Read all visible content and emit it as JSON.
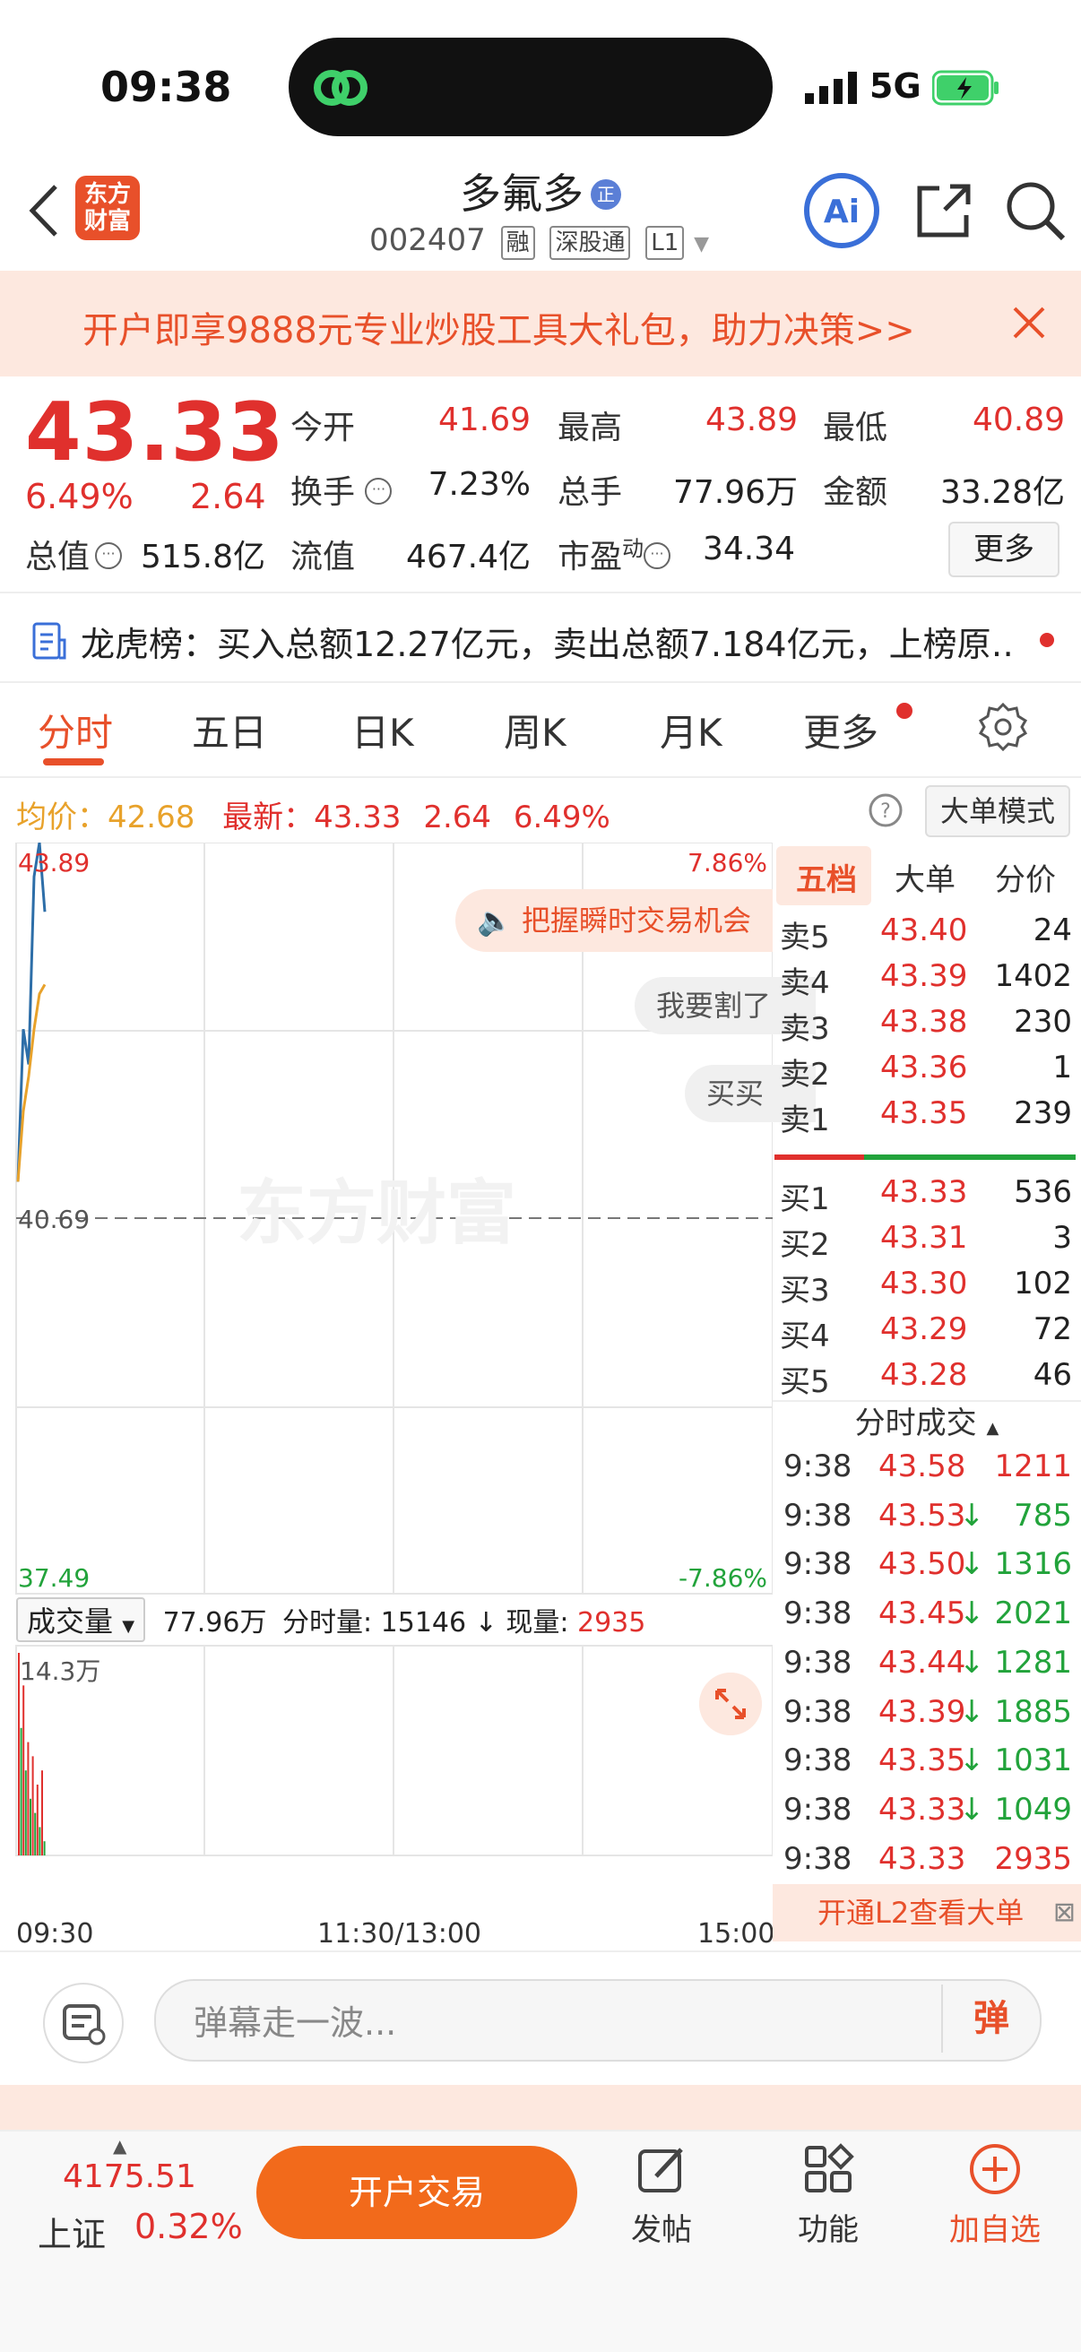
{
  "status": {
    "time": "09:38",
    "network": "5G"
  },
  "header": {
    "title": "多氟多",
    "title_badge": "正",
    "logo": "东方财富",
    "code": "002407",
    "tags": [
      "融",
      "深股通",
      "L1"
    ],
    "ai_label": "Ai"
  },
  "promo": {
    "text": "开户即享9888元专业炒股工具大礼包，助力决策>>"
  },
  "quote": {
    "price": "43.33",
    "change_pct": "6.49%",
    "change": "2.64",
    "open_label": "今开",
    "open": "41.69",
    "high_label": "最高",
    "high": "43.89",
    "low_label": "最低",
    "low": "40.89",
    "turnover_label": "换手",
    "turnover": "7.23%",
    "volume_label": "总手",
    "volume": "77.96万",
    "amount_label": "金额",
    "amount": "33.28亿",
    "mktcap_label": "总值",
    "mktcap": "515.8亿",
    "float_label": "流值",
    "float": "467.4亿",
    "pe_label": "市盈",
    "pe_sup": "动",
    "pe": "34.34",
    "more_label": "更多"
  },
  "lhb": {
    "text": "龙虎榜：买入总额12.27亿元，卖出总额7.184亿元，上榜原…"
  },
  "tabs": [
    "分时",
    "五日",
    "日K",
    "周K",
    "月K",
    "更多"
  ],
  "avg_row": {
    "avg_label": "均价：",
    "avg": "42.68",
    "last_label": "最新：",
    "last": "43.33",
    "chg": "2.64",
    "pct": "6.49%",
    "mode_label": "大单模式"
  },
  "chart": {
    "y_top": "43.89",
    "y_mid": "40.69",
    "y_bottom": "37.49",
    "pct_top": "7.86%",
    "pct_bottom": "-7.86%",
    "watermark": "东方财富",
    "pill_opportunity": "把握瞬时交易机会",
    "pill_cut": "我要割了",
    "pill_buy": "买买",
    "vol_select": "成交量",
    "vol_total": "77.96万",
    "vol_minute_label": "分时量:",
    "vol_minute": "15146",
    "vol_now_label": "现量:",
    "vol_now": "2935",
    "vol_max": "14.3万",
    "time_start": "09:30",
    "time_mid": "11:30/13:00",
    "time_end": "15:00"
  },
  "chart_data": {
    "type": "line",
    "series": [
      {
        "name": "",
        "values": [
          41.0,
          42.3,
          42.0,
          43.6,
          43.89,
          43.3
        ]
      },
      {
        "name": "",
        "values": [
          41.0,
          41.6,
          41.9,
          42.3,
          42.6,
          42.68
        ]
      }
    ],
    "ylim": [
      37.49,
      43.89
    ],
    "volume": [
      143000,
      90000,
      120000,
      60000,
      80000,
      40000,
      70000,
      30000,
      50000,
      20000,
      60000,
      10000
    ]
  },
  "orderbook": {
    "tabs": [
      "五档",
      "大单",
      "分价"
    ],
    "asks": [
      {
        "label": "卖5",
        "price": "43.40",
        "vol": "24"
      },
      {
        "label": "卖4",
        "price": "43.39",
        "vol": "1402"
      },
      {
        "label": "卖3",
        "price": "43.38",
        "vol": "230"
      },
      {
        "label": "卖2",
        "price": "43.36",
        "vol": "1"
      },
      {
        "label": "卖1",
        "price": "43.35",
        "vol": "239"
      }
    ],
    "bids": [
      {
        "label": "买1",
        "price": "43.33",
        "vol": "536"
      },
      {
        "label": "买2",
        "price": "43.31",
        "vol": "3"
      },
      {
        "label": "买3",
        "price": "43.30",
        "vol": "102"
      },
      {
        "label": "买4",
        "price": "43.29",
        "vol": "72"
      },
      {
        "label": "买5",
        "price": "43.28",
        "vol": "46"
      }
    ],
    "trades_header": "分时成交",
    "trades": [
      {
        "time": "9:38",
        "price": "43.58",
        "arrow": "",
        "vol": "1211",
        "color": "red"
      },
      {
        "time": "9:38",
        "price": "43.53",
        "arrow": "↓",
        "vol": "785",
        "color": "green"
      },
      {
        "time": "9:38",
        "price": "43.50",
        "arrow": "↓",
        "vol": "1316",
        "color": "green"
      },
      {
        "time": "9:38",
        "price": "43.45",
        "arrow": "↓",
        "vol": "2021",
        "color": "green"
      },
      {
        "time": "9:38",
        "price": "43.44",
        "arrow": "↓",
        "vol": "1281",
        "color": "green"
      },
      {
        "time": "9:38",
        "price": "43.39",
        "arrow": "↓",
        "vol": "1885",
        "color": "green"
      },
      {
        "time": "9:38",
        "price": "43.35",
        "arrow": "↓",
        "vol": "1031",
        "color": "green"
      },
      {
        "time": "9:38",
        "price": "43.33",
        "arrow": "↓",
        "vol": "1049",
        "color": "green"
      },
      {
        "time": "9:38",
        "price": "43.33",
        "arrow": "",
        "vol": "2935",
        "color": "red"
      }
    ],
    "l2_banner": "开通L2查看大单"
  },
  "comment": {
    "placeholder": "弹幕走一波...",
    "danmu": "弹"
  },
  "bottom": {
    "index_value": "4175.51",
    "index_name": "上证",
    "index_pct": "0.32%",
    "trade_label": "开户交易",
    "post_label": "发帖",
    "func_label": "功能",
    "fav_label": "加自选"
  },
  "colors": {
    "red": "#e0302d",
    "green": "#22a33b",
    "accent": "#e8502a",
    "avg": "#e8a22b",
    "line": "#2d6ea8"
  }
}
